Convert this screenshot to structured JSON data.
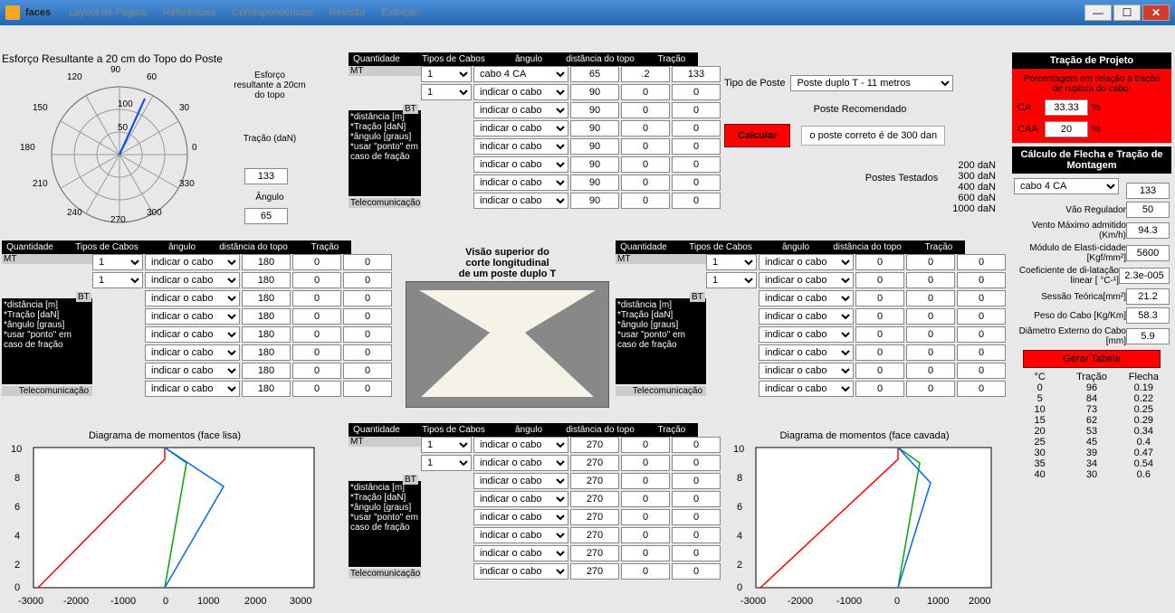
{
  "window": {
    "title": "faces",
    "menu": [
      "Layout de Página",
      "Referências",
      "Correspondências",
      "Revisão",
      "Exibição"
    ]
  },
  "polar": {
    "title": "Esforço Resultante a 20 cm do Topo do Poste",
    "ticks": [
      "0",
      "30",
      "60",
      "90",
      "120",
      "150",
      "180",
      "210",
      "240",
      "270",
      "300",
      "330"
    ],
    "r_ticks": [
      "50",
      "100"
    ],
    "side_label": "Esforço resultante a 20cm do topo",
    "tracao_lbl": "Tração (daN)",
    "tracao_val": "133",
    "angulo_lbl": "Ângulo",
    "angulo_val": "65"
  },
  "headers": {
    "qtd": "Quantidade",
    "tipos": "Tipos de Cabos",
    "ang": "ângulo",
    "dist": "distância do topo",
    "trac": "Tração"
  },
  "tags": {
    "mt": "MT",
    "bt": "BT",
    "tele": "Telecomunicação"
  },
  "note": "*distância [m]\n*Tração [daN]\n*ângulo [graus]\n*usar \"ponto\" em caso de fração",
  "mt1": {
    "rows": [
      {
        "q": "1",
        "cabo": "cabo 4 CA",
        "a": "65",
        "d": ".2",
        "t": "133"
      },
      {
        "q": "1",
        "cabo": "indicar o cabo",
        "a": "90",
        "d": "0",
        "t": "0"
      },
      {
        "q": "",
        "cabo": "indicar o cabo",
        "a": "90",
        "d": "0",
        "t": "0"
      },
      {
        "q": "",
        "cabo": "indicar o cabo",
        "a": "90",
        "d": "0",
        "t": "0"
      },
      {
        "q": "",
        "cabo": "indicar o cabo",
        "a": "90",
        "d": "0",
        "t": "0"
      },
      {
        "q": "",
        "cabo": "indicar o cabo",
        "a": "90",
        "d": "0",
        "t": "0"
      },
      {
        "q": "",
        "cabo": "indicar o cabo",
        "a": "90",
        "d": "0",
        "t": "0"
      },
      {
        "q": "",
        "cabo": "indicar o cabo",
        "a": "90",
        "d": "0",
        "t": "0"
      }
    ]
  },
  "tipo": {
    "label": "Tipo de Poste",
    "value": "Poste duplo T - 11 metros",
    "recom_lbl": "Poste Recomendado",
    "calc_btn": "Calcular",
    "result": "o poste correto é de 300 dan",
    "test_lbl": "Postes Testados",
    "list": [
      "200 daN",
      "300 daN",
      "400 daN",
      "600 daN",
      "1000 daN"
    ]
  },
  "left": {
    "rows": [
      {
        "q": "1",
        "cabo": "indicar o cabo",
        "a": "180",
        "d": "0",
        "t": "0"
      },
      {
        "q": "1",
        "cabo": "indicar o cabo",
        "a": "180",
        "d": "0",
        "t": "0"
      },
      {
        "q": "",
        "cabo": "indicar o cabo",
        "a": "180",
        "d": "0",
        "t": "0"
      },
      {
        "q": "",
        "cabo": "indicar o cabo",
        "a": "180",
        "d": "0",
        "t": "0"
      },
      {
        "q": "",
        "cabo": "indicar o cabo",
        "a": "180",
        "d": "0",
        "t": "0"
      },
      {
        "q": "",
        "cabo": "indicar o cabo",
        "a": "180",
        "d": "0",
        "t": "0"
      },
      {
        "q": "",
        "cabo": "indicar o cabo",
        "a": "180",
        "d": "0",
        "t": "0"
      },
      {
        "q": "",
        "cabo": "indicar o cabo",
        "a": "180",
        "d": "0",
        "t": "0"
      }
    ]
  },
  "right": {
    "rows": [
      {
        "q": "1",
        "cabo": "indicar o cabo",
        "a": "0",
        "d": "0",
        "t": "0"
      },
      {
        "q": "1",
        "cabo": "indicar o cabo",
        "a": "0",
        "d": "0",
        "t": "0"
      },
      {
        "q": "",
        "cabo": "indicar o cabo",
        "a": "0",
        "d": "0",
        "t": "0"
      },
      {
        "q": "",
        "cabo": "indicar o cabo",
        "a": "0",
        "d": "0",
        "t": "0"
      },
      {
        "q": "",
        "cabo": "indicar o cabo",
        "a": "0",
        "d": "0",
        "t": "0"
      },
      {
        "q": "",
        "cabo": "indicar o cabo",
        "a": "0",
        "d": "0",
        "t": "0"
      },
      {
        "q": "",
        "cabo": "indicar o cabo",
        "a": "0",
        "d": "0",
        "t": "0"
      },
      {
        "q": "",
        "cabo": "indicar o cabo",
        "a": "0",
        "d": "0",
        "t": "0"
      }
    ]
  },
  "bottom": {
    "rows": [
      {
        "q": "1",
        "cabo": "indicar o cabo",
        "a": "270",
        "d": "0",
        "t": "0"
      },
      {
        "q": "1",
        "cabo": "indicar o cabo",
        "a": "270",
        "d": "0",
        "t": "0"
      },
      {
        "q": "",
        "cabo": "indicar o cabo",
        "a": "270",
        "d": "0",
        "t": "0"
      },
      {
        "q": "",
        "cabo": "indicar o cabo",
        "a": "270",
        "d": "0",
        "t": "0"
      },
      {
        "q": "",
        "cabo": "indicar o cabo",
        "a": "270",
        "d": "0",
        "t": "0"
      },
      {
        "q": "",
        "cabo": "indicar o cabo",
        "a": "270",
        "d": "0",
        "t": "0"
      },
      {
        "q": "",
        "cabo": "indicar o cabo",
        "a": "270",
        "d": "0",
        "t": "0"
      },
      {
        "q": "",
        "cabo": "indicar o cabo",
        "a": "270",
        "d": "0",
        "t": "0"
      }
    ]
  },
  "cross": {
    "line1": "Visão superior do",
    "line2": "corte longitudinal",
    "line3": "de um poste duplo T"
  },
  "proj": {
    "title": "Tração de Projeto",
    "sub": "Porcentagem em relação a tração de ruptura do cabo:",
    "ca_lbl": "CA",
    "ca_val": "33.33",
    "pct": "%",
    "caa_lbl": "CAA",
    "caa_val": "20"
  },
  "flecha": {
    "title": "Cálculo de Flecha e Tração de Montagem",
    "cabo": "cabo 4 CA",
    "trac_lbl": "Tração",
    "trac": "133",
    "vao_lbl": "Vão Regulador",
    "vao": "50",
    "vento_lbl": "Vento Máximo admitido (Km/h)",
    "vento": "94.3",
    "mod_lbl": "Módulo de Elasti-cidade [Kgf/mm²]",
    "mod": "5600",
    "coef_lbl": "Coeficiente de di-latação linear [ °C-¹]",
    "coef": "2.3e-005",
    "sess_lbl": "Sessão Teórica[mm²]",
    "sess": "21.2",
    "peso_lbl": "Peso do Cabo [Kg/Km]",
    "peso": "58.3",
    "diam_lbl": "Diâmetro Externo do Cabo [mm]",
    "diam": "5.9",
    "btn": "Gerar Tabela",
    "hdr_temp": "°C",
    "hdr_trac": "Tração",
    "hdr_flecha": "Flecha",
    "rows": [
      {
        "c": "0",
        "t": "96",
        "f": "0.19"
      },
      {
        "c": "5",
        "t": "84",
        "f": "0.22"
      },
      {
        "c": "10",
        "t": "73",
        "f": "0.25"
      },
      {
        "c": "15",
        "t": "62",
        "f": "0.29"
      },
      {
        "c": "20",
        "t": "53",
        "f": "0.34"
      },
      {
        "c": "25",
        "t": "45",
        "f": "0.4"
      },
      {
        "c": "30",
        "t": "39",
        "f": "0.47"
      },
      {
        "c": "35",
        "t": "34",
        "f": "0.54"
      },
      {
        "c": "40",
        "t": "30",
        "f": "0.6"
      }
    ]
  },
  "diag_lisa": {
    "title": "Diagrama de momentos (face lisa)"
  },
  "diag_cavada": {
    "title": "Diagrama de momentos (face cavada)"
  },
  "chart_data": [
    {
      "type": "polar-line",
      "title": "Esforço Resultante a 20 cm do Topo do Poste",
      "angle_deg": 65,
      "radius": 133,
      "r_ticks": [
        50,
        100
      ],
      "theta_ticks": [
        0,
        30,
        60,
        90,
        120,
        150,
        180,
        210,
        240,
        270,
        300,
        330
      ]
    },
    {
      "type": "line",
      "title": "Diagrama de momentos (face lisa)",
      "xlim": [
        -3000,
        3000
      ],
      "ylim": [
        0,
        10
      ],
      "x_ticks": [
        -3000,
        -2000,
        -1000,
        0,
        1000,
        2000,
        3000
      ],
      "y_ticks": [
        0,
        2,
        4,
        6,
        8,
        10
      ],
      "series": [
        {
          "name": "red",
          "color": "#ff0000",
          "x": [
            -2700,
            0,
            0
          ],
          "y": [
            0,
            9,
            10
          ]
        },
        {
          "name": "green",
          "color": "#00aa00",
          "x": [
            0,
            460,
            0
          ],
          "y": [
            10,
            8.8,
            0
          ]
        },
        {
          "name": "blue",
          "color": "#0066ff",
          "x": [
            0,
            1270,
            0
          ],
          "y": [
            10,
            7.2,
            0
          ]
        }
      ]
    },
    {
      "type": "line",
      "title": "Diagrama de momentos (face cavada)",
      "xlim": [
        -3000,
        2000
      ],
      "ylim": [
        0,
        10
      ],
      "x_ticks": [
        -3000,
        -2000,
        -1000,
        0,
        1000,
        2000
      ],
      "y_ticks": [
        0,
        2,
        4,
        6,
        8,
        10
      ],
      "series": [
        {
          "name": "red",
          "color": "#ff0000",
          "x": [
            -2700,
            0,
            0
          ],
          "y": [
            0,
            9,
            10
          ]
        },
        {
          "name": "green",
          "color": "#00aa00",
          "x": [
            0,
            460,
            0
          ],
          "y": [
            10,
            8.8,
            0
          ]
        },
        {
          "name": "blue",
          "color": "#0066ff",
          "x": [
            0,
            700,
            0
          ],
          "y": [
            10,
            7.4,
            0
          ]
        }
      ]
    }
  ]
}
